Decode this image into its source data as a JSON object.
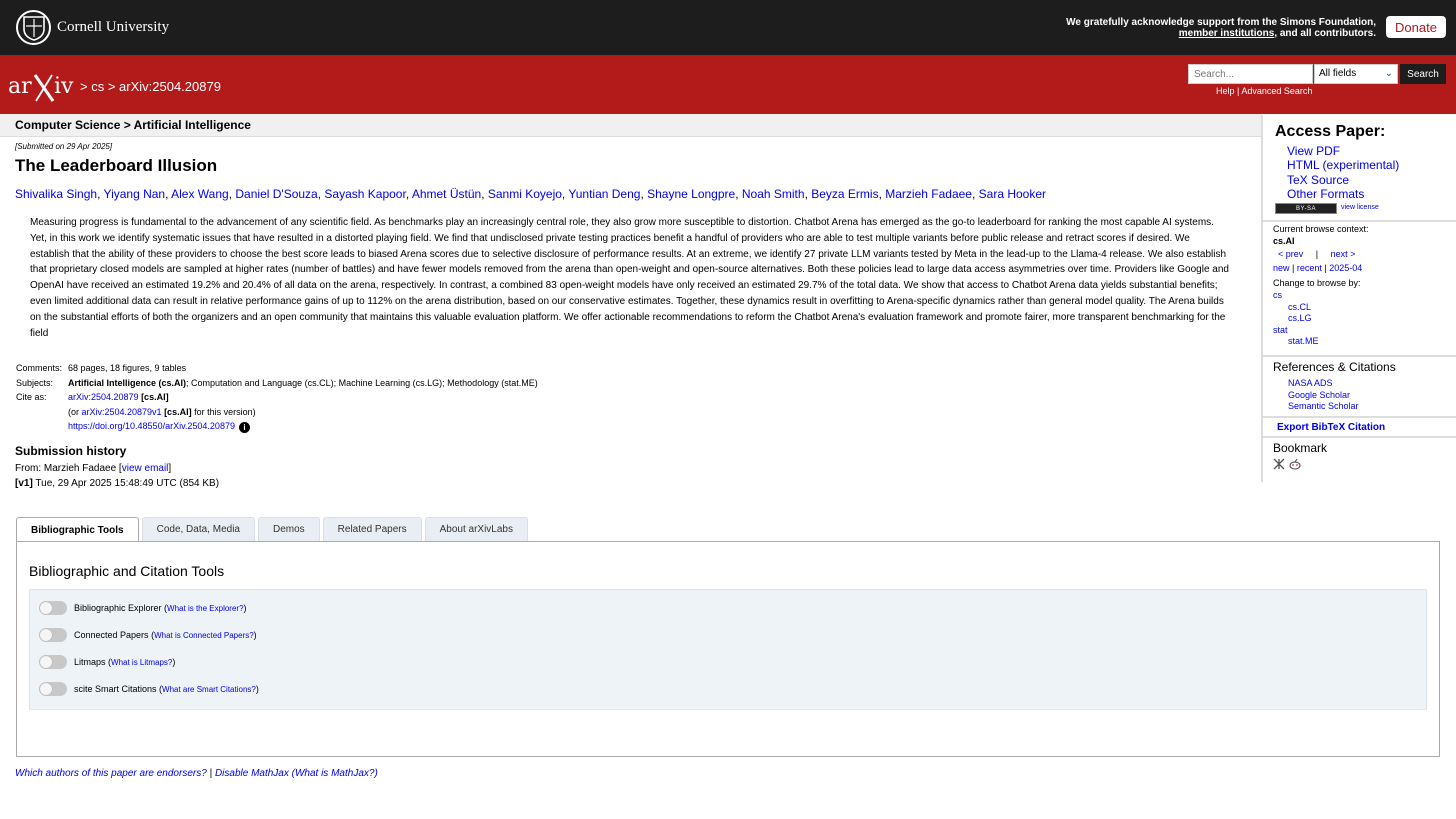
{
  "topbar": {
    "university": "Cornell University",
    "ack_text": "We gratefully acknowledge support from the Simons Foundation,",
    "ack_link": "member institutions",
    "ack_end": ", and all contributors.",
    "donate": "Donate"
  },
  "header": {
    "breadcrumb": "> cs > arXiv:2504.20879",
    "search_placeholder": "Search...",
    "field_selected": "All fields",
    "search_button": "Search",
    "help": "Help",
    "help_sep": " | ",
    "advanced": "Advanced Search"
  },
  "subheader": "Computer Science > Artificial Intelligence",
  "paper": {
    "submitted": "[Submitted on 29 Apr 2025]",
    "title": "The Leaderboard Illusion",
    "authors": [
      "Shivalika Singh",
      "Yiyang Nan",
      "Alex Wang",
      "Daniel D'Souza",
      "Sayash Kapoor",
      "Ahmet Üstün",
      "Sanmi Koyejo",
      "Yuntian Deng",
      "Shayne Longpre",
      "Noah Smith",
      "Beyza Ermis",
      "Marzieh Fadaee",
      "Sara Hooker"
    ],
    "abstract": "Measuring progress is fundamental to the advancement of any scientific field. As benchmarks play an increasingly central role, they also grow more susceptible to distortion. Chatbot Arena has emerged as the go-to leaderboard for ranking the most capable AI systems. Yet, in this work we identify systematic issues that have resulted in a distorted playing field. We find that undisclosed private testing practices benefit a handful of providers who are able to test multiple variants before public release and retract scores if desired. We establish that the ability of these providers to choose the best score leads to biased Arena scores due to selective disclosure of performance results. At an extreme, we identify 27 private LLM variants tested by Meta in the lead-up to the Llama-4 release. We also establish that proprietary closed models are sampled at higher rates (number of battles) and have fewer models removed from the arena than open-weight and open-source alternatives. Both these policies lead to large data access asymmetries over time. Providers like Google and OpenAI have received an estimated 19.2% and 20.4% of all data on the arena, respectively. In contrast, a combined 83 open-weight models have only received an estimated 29.7% of the total data. We show that access to Chatbot Arena data yields substantial benefits; even limited additional data can result in relative performance gains of up to 112% on the arena distribution, based on our conservative estimates. Together, these dynamics result in overfitting to Arena-specific dynamics rather than general model quality. The Arena builds on the substantial efforts of both the organizers and an open community that maintains this valuable evaluation platform. We offer actionable recommendations to reform the Chatbot Arena's evaluation framework and promote fairer, more transparent benchmarking for the field"
  },
  "meta": {
    "comments_label": "Comments:",
    "comments": "68 pages, 18 figures, 9 tables",
    "subjects_label": "Subjects:",
    "subjects_primary": "Artificial Intelligence (cs.AI)",
    "subjects_rest": "; Computation and Language (cs.CL); Machine Learning (cs.LG); Methodology (stat.ME)",
    "cite_label": "Cite as:",
    "cite_id": "arXiv:2504.20879",
    "cite_cat": " [cs.AI]",
    "cite_or": "(or ",
    "cite_v1": "arXiv:2504.20879v1",
    "cite_v1_rest": " for this version)",
    "cite_v1_cat": " [cs.AI]",
    "doi": "https://doi.org/10.48550/arXiv.2504.20879"
  },
  "history": {
    "title": "Submission history",
    "from": "From: Marzieh Fadaee [",
    "view_email": "view email",
    "from_end": "]",
    "v1": "[v1]",
    "v1_date": " Tue, 29 Apr 2025 15:48:49 UTC (854 KB)"
  },
  "tabs": [
    "Bibliographic Tools",
    "Code, Data, Media",
    "Demos",
    "Related Papers",
    "About arXivLabs"
  ],
  "tools": {
    "title": "Bibliographic and Citation Tools",
    "items": [
      {
        "name": "Bibliographic Explorer",
        "q": "What is the Explorer?"
      },
      {
        "name": "Connected Papers",
        "q": "What is Connected Papers?"
      },
      {
        "name": "Litmaps",
        "q": "What is Litmaps?"
      },
      {
        "name": "scite Smart Citations",
        "q": "What are Smart Citations?"
      }
    ]
  },
  "footer": {
    "endorsers": "Which authors of this paper are endorsers?",
    "sep": " | ",
    "mathjax": "Disable MathJax",
    "what_mathjax": "(What is MathJax?)"
  },
  "sidebar": {
    "access_title": "Access Paper:",
    "access_links": [
      "View PDF",
      "HTML (experimental)",
      "TeX Source",
      "Other Formats"
    ],
    "cc_badge": "BY-SA",
    "view_license": "view license",
    "context_label": "Current browse context:",
    "context": "cs.AI",
    "prev": "< prev",
    "nav_sep": "|",
    "next": "next >",
    "new": "new",
    "recent": "recent",
    "month": "2025-04",
    "change_label": "Change to browse by:",
    "browse": [
      {
        "label": "cs",
        "indent": false
      },
      {
        "label": "cs.CL",
        "indent": true
      },
      {
        "label": "cs.LG",
        "indent": true
      },
      {
        "label": "stat",
        "indent": false
      },
      {
        "label": "stat.ME",
        "indent": true
      }
    ],
    "refs_title": "References & Citations",
    "refs": [
      "NASA ADS",
      "Google Scholar",
      "Semantic Scholar"
    ],
    "export": "Export BibTeX Citation",
    "bookmark": "Bookmark"
  }
}
